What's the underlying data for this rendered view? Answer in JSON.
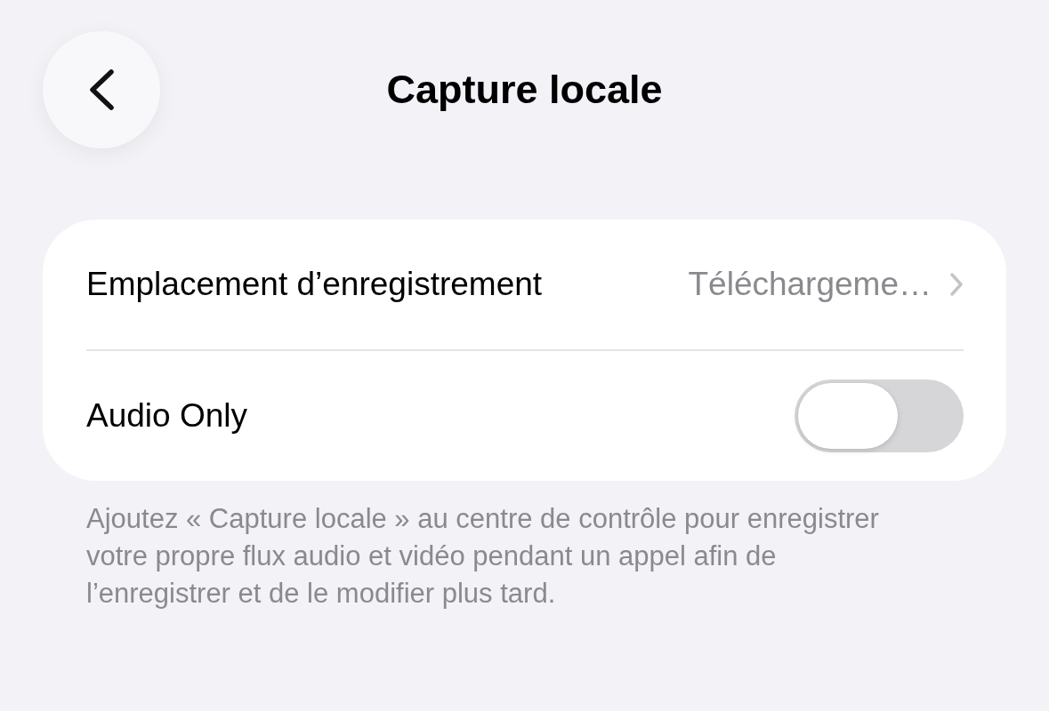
{
  "header": {
    "title": "Capture locale"
  },
  "settings": [
    {
      "kind": "link",
      "label": "Emplacement d’enregistrement",
      "value": "Téléchargeme…"
    },
    {
      "kind": "toggle",
      "label": "Audio Only",
      "on": false
    }
  ],
  "footer": "Ajoutez « Capture locale » au centre de contrôle pour enregistrer votre propre flux audio et vidéo pendant un appel afin de l’enregistrer et de le modifier plus tard."
}
